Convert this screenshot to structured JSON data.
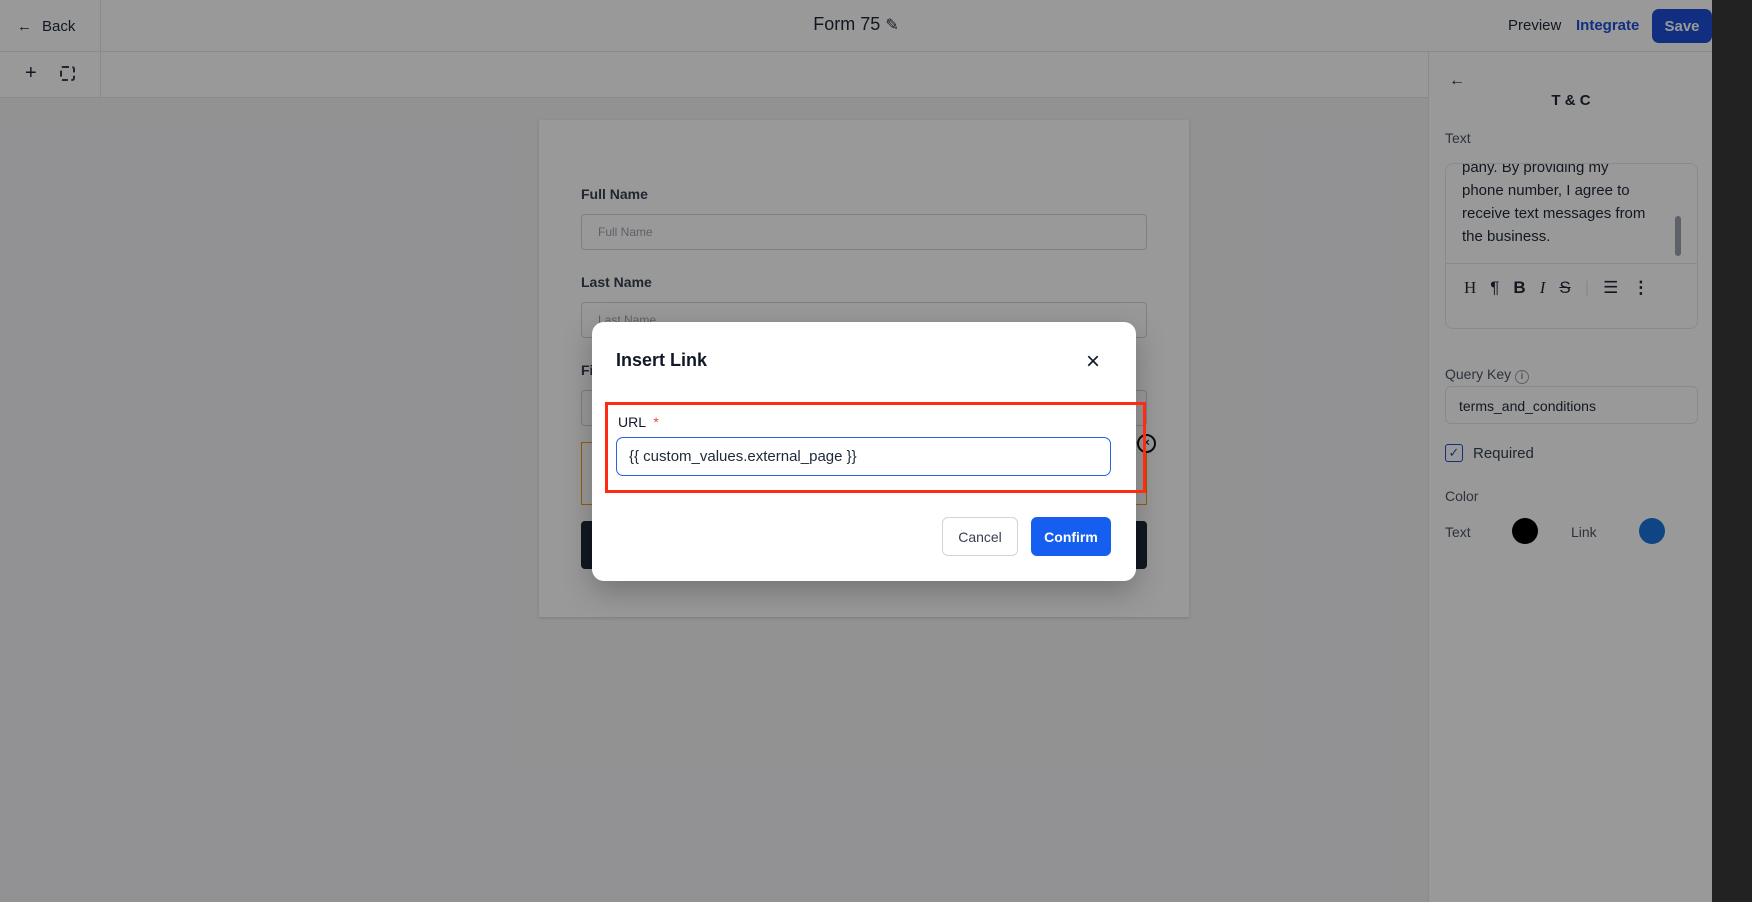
{
  "header": {
    "back_label": "Back",
    "title": "Form 75",
    "preview": "Preview",
    "integrate": "Integrate",
    "save": "Save"
  },
  "form": {
    "fields": [
      {
        "label": "Full Name",
        "placeholder": "Full Name"
      },
      {
        "label": "Last Name",
        "placeholder": "Last Name"
      },
      {
        "label": "Fi"
      }
    ]
  },
  "modal": {
    "title": "Insert Link",
    "url_label": "URL",
    "required_mark": "*",
    "url_value": "{{ custom_values.external_page }}",
    "cancel": "Cancel",
    "confirm": "Confirm",
    "highlight_color": "#ff2a12"
  },
  "panel": {
    "title": "T & C",
    "text_label": "Text",
    "text_content": [
      "pany. By providing my",
      "phone number, I agree to",
      "receive text messages from",
      "the business."
    ],
    "toolbar": [
      "heading-icon",
      "paragraph-icon",
      "bold-icon",
      "italic-icon",
      "strikethrough-icon",
      "bullet-list-icon",
      "more-icon"
    ],
    "query_key_label": "Query Key",
    "query_key_value": "terms_and_conditions",
    "required_label": "Required",
    "required_checked": true,
    "color_label": "Color",
    "text_color_label": "Text",
    "text_color": "#000000",
    "link_color_label": "Link",
    "link_color": "#1a73d9"
  },
  "colors": {
    "accent": "#1d4ed8",
    "confirm": "#155eef"
  }
}
